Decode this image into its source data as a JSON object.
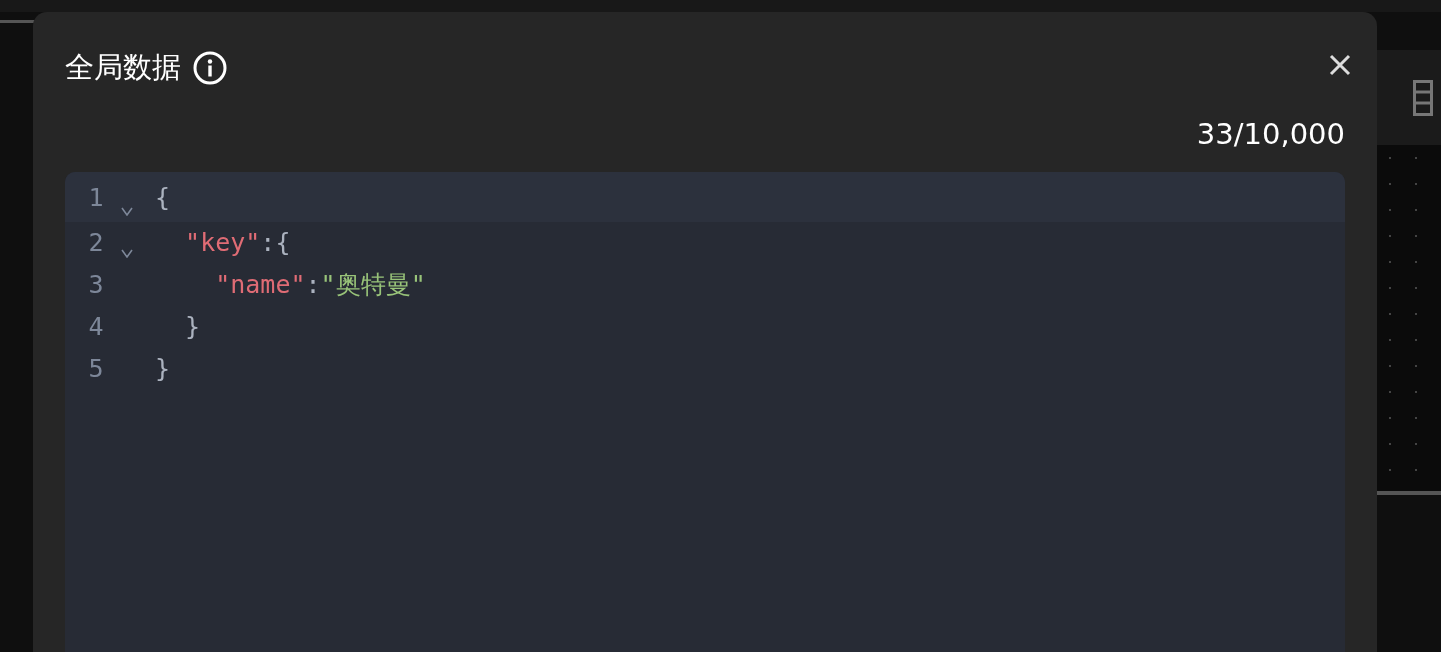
{
  "dialog": {
    "title": "全局数据",
    "counter": "33/10,000",
    "editor": {
      "lines": [
        {
          "number": "1",
          "foldable": true,
          "active": true,
          "tokens": [
            {
              "kind": "punct",
              "text": "{"
            }
          ]
        },
        {
          "number": "2",
          "foldable": true,
          "active": false,
          "tokens": [
            {
              "kind": "key",
              "text": "  \"key\""
            },
            {
              "kind": "punct",
              "text": ":{"
            }
          ]
        },
        {
          "number": "3",
          "foldable": false,
          "active": false,
          "tokens": [
            {
              "kind": "key",
              "text": "    \"name\""
            },
            {
              "kind": "punct",
              "text": ":"
            },
            {
              "kind": "string",
              "text": "\"奥特曼\""
            }
          ]
        },
        {
          "number": "4",
          "foldable": false,
          "active": false,
          "tokens": [
            {
              "kind": "punct",
              "text": "  }"
            }
          ]
        },
        {
          "number": "5",
          "foldable": false,
          "active": false,
          "tokens": [
            {
              "kind": "punct",
              "text": "}"
            }
          ]
        }
      ]
    }
  }
}
